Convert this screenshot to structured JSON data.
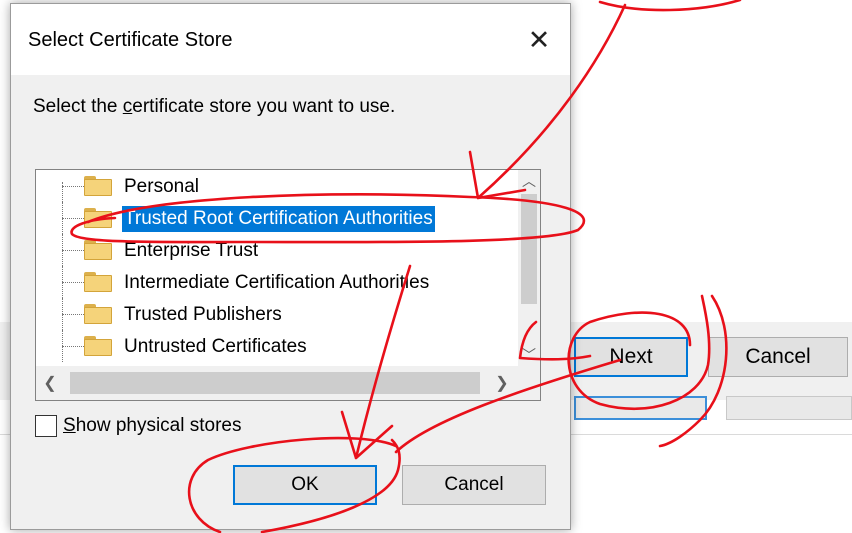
{
  "background_window": {
    "next_label": "Next",
    "cancel_label": "Cancel"
  },
  "dialog": {
    "title": "Select Certificate Store",
    "close_icon": "close-icon",
    "prompt_prefix": "Select the ",
    "prompt_accel": "c",
    "prompt_suffix": "ertificate store you want to use.",
    "tree": {
      "items": [
        {
          "label": "Personal",
          "icon": "folder-icon",
          "selected": false
        },
        {
          "label": "Trusted Root Certification Authorities",
          "icon": "folder-icon",
          "selected": true
        },
        {
          "label": "Enterprise Trust",
          "icon": "folder-icon",
          "selected": false
        },
        {
          "label": "Intermediate Certification Authorities",
          "icon": "folder-icon",
          "selected": false
        },
        {
          "label": "Trusted Publishers",
          "icon": "folder-icon",
          "selected": false
        },
        {
          "label": "Untrusted Certificates",
          "icon": "folder-icon",
          "selected": false
        }
      ],
      "scroll_up_icon": "chevron-up-icon",
      "scroll_down_icon": "chevron-down-icon",
      "scroll_left_icon": "chevron-left-icon",
      "scroll_right_icon": "chevron-right-icon"
    },
    "show_physical_accel": "S",
    "show_physical_rest": "how physical stores",
    "show_physical_checked": false,
    "ok_label": "OK",
    "cancel_label": "Cancel"
  },
  "colors": {
    "selection": "#0078d7",
    "annotation": "#e8101a",
    "dialog_body": "#f0f0f0"
  }
}
